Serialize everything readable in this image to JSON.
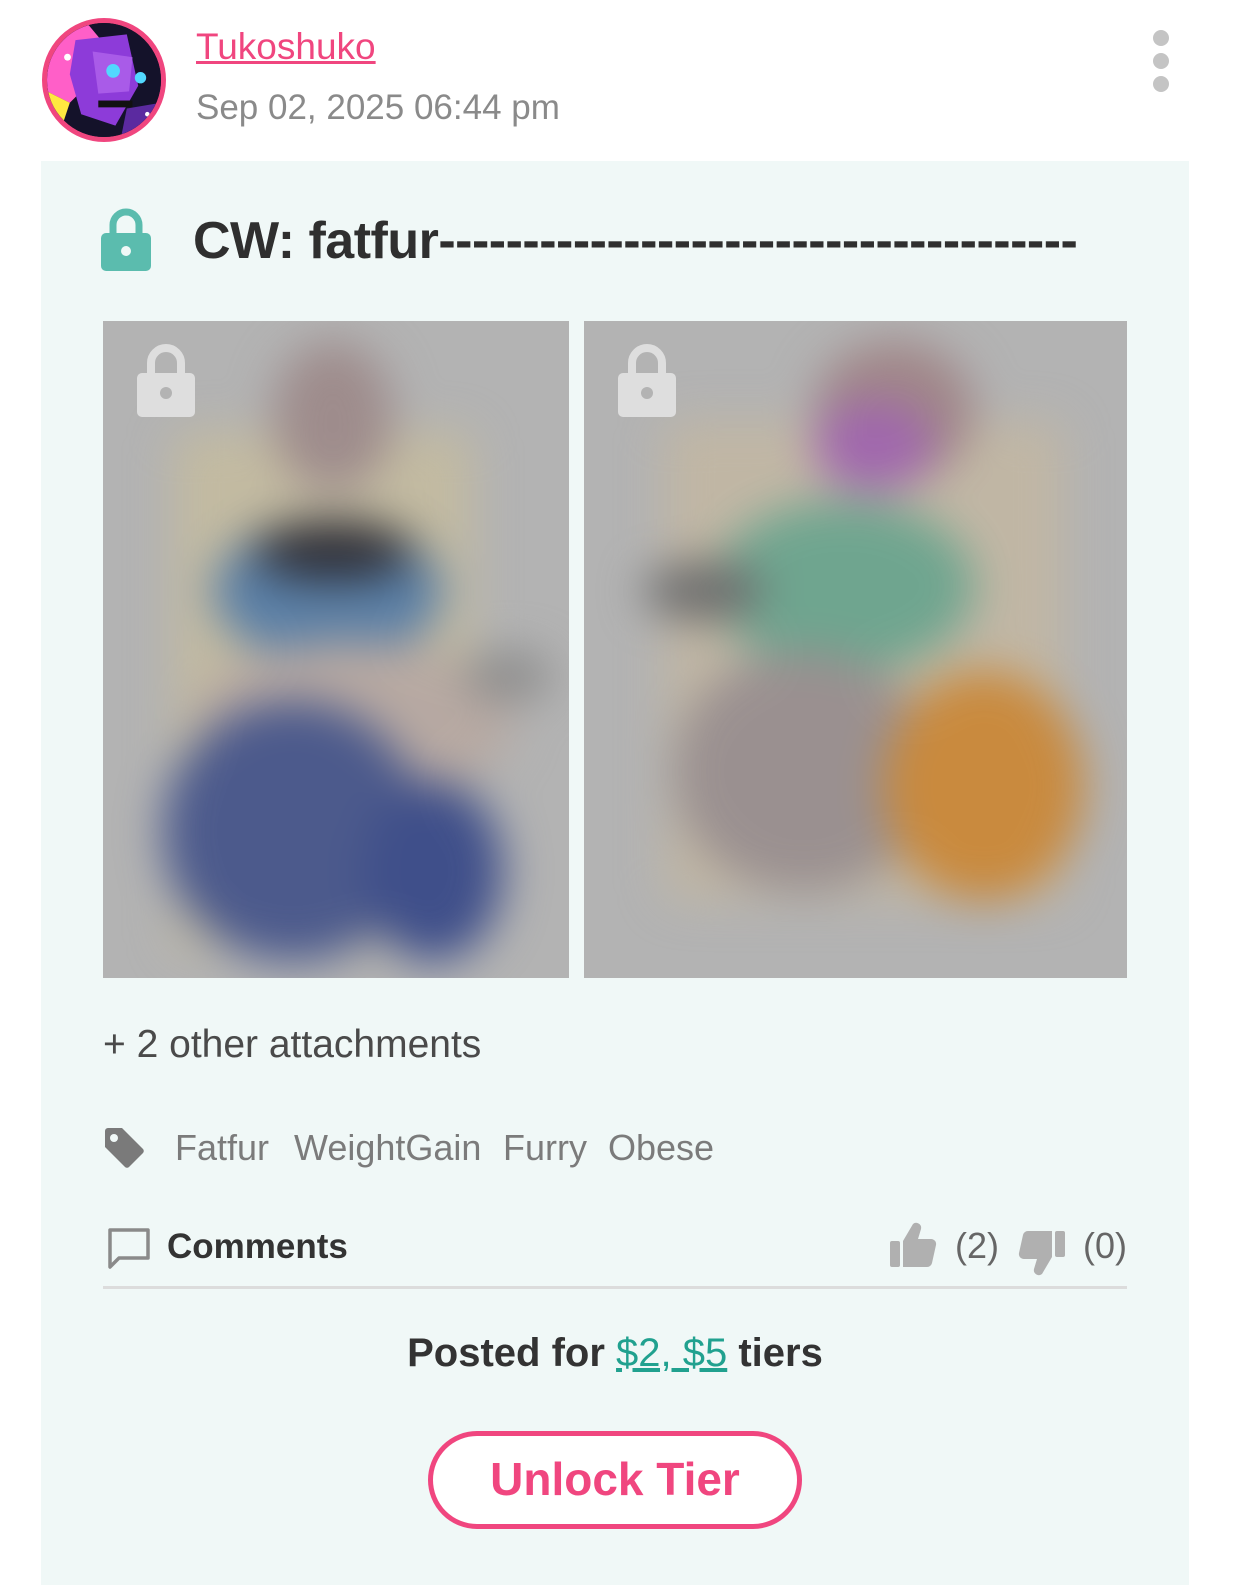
{
  "colors": {
    "accent": "#f0467f",
    "teal": "#21a18f",
    "card_background": "#f0f8f7"
  },
  "author": {
    "name": "Tukoshuko",
    "avatar_icon": "avatar-image"
  },
  "post": {
    "date": "Sep 02, 2025 06:44 pm",
    "title": "CW: fatfur--------------------------------------",
    "lock_icon": "lock-icon",
    "attachments_note": "+ 2 other attachments",
    "tags": [
      "Fatfur",
      "WeightGain",
      "Furry",
      "Obese"
    ]
  },
  "comments": {
    "label": "Comments",
    "likes": "(2)",
    "dislikes": "(0)"
  },
  "tiers": {
    "prefix": "Posted for ",
    "link_text": "$2, $5",
    "suffix": " tiers"
  },
  "unlock_button": {
    "label": "Unlock Tier"
  }
}
